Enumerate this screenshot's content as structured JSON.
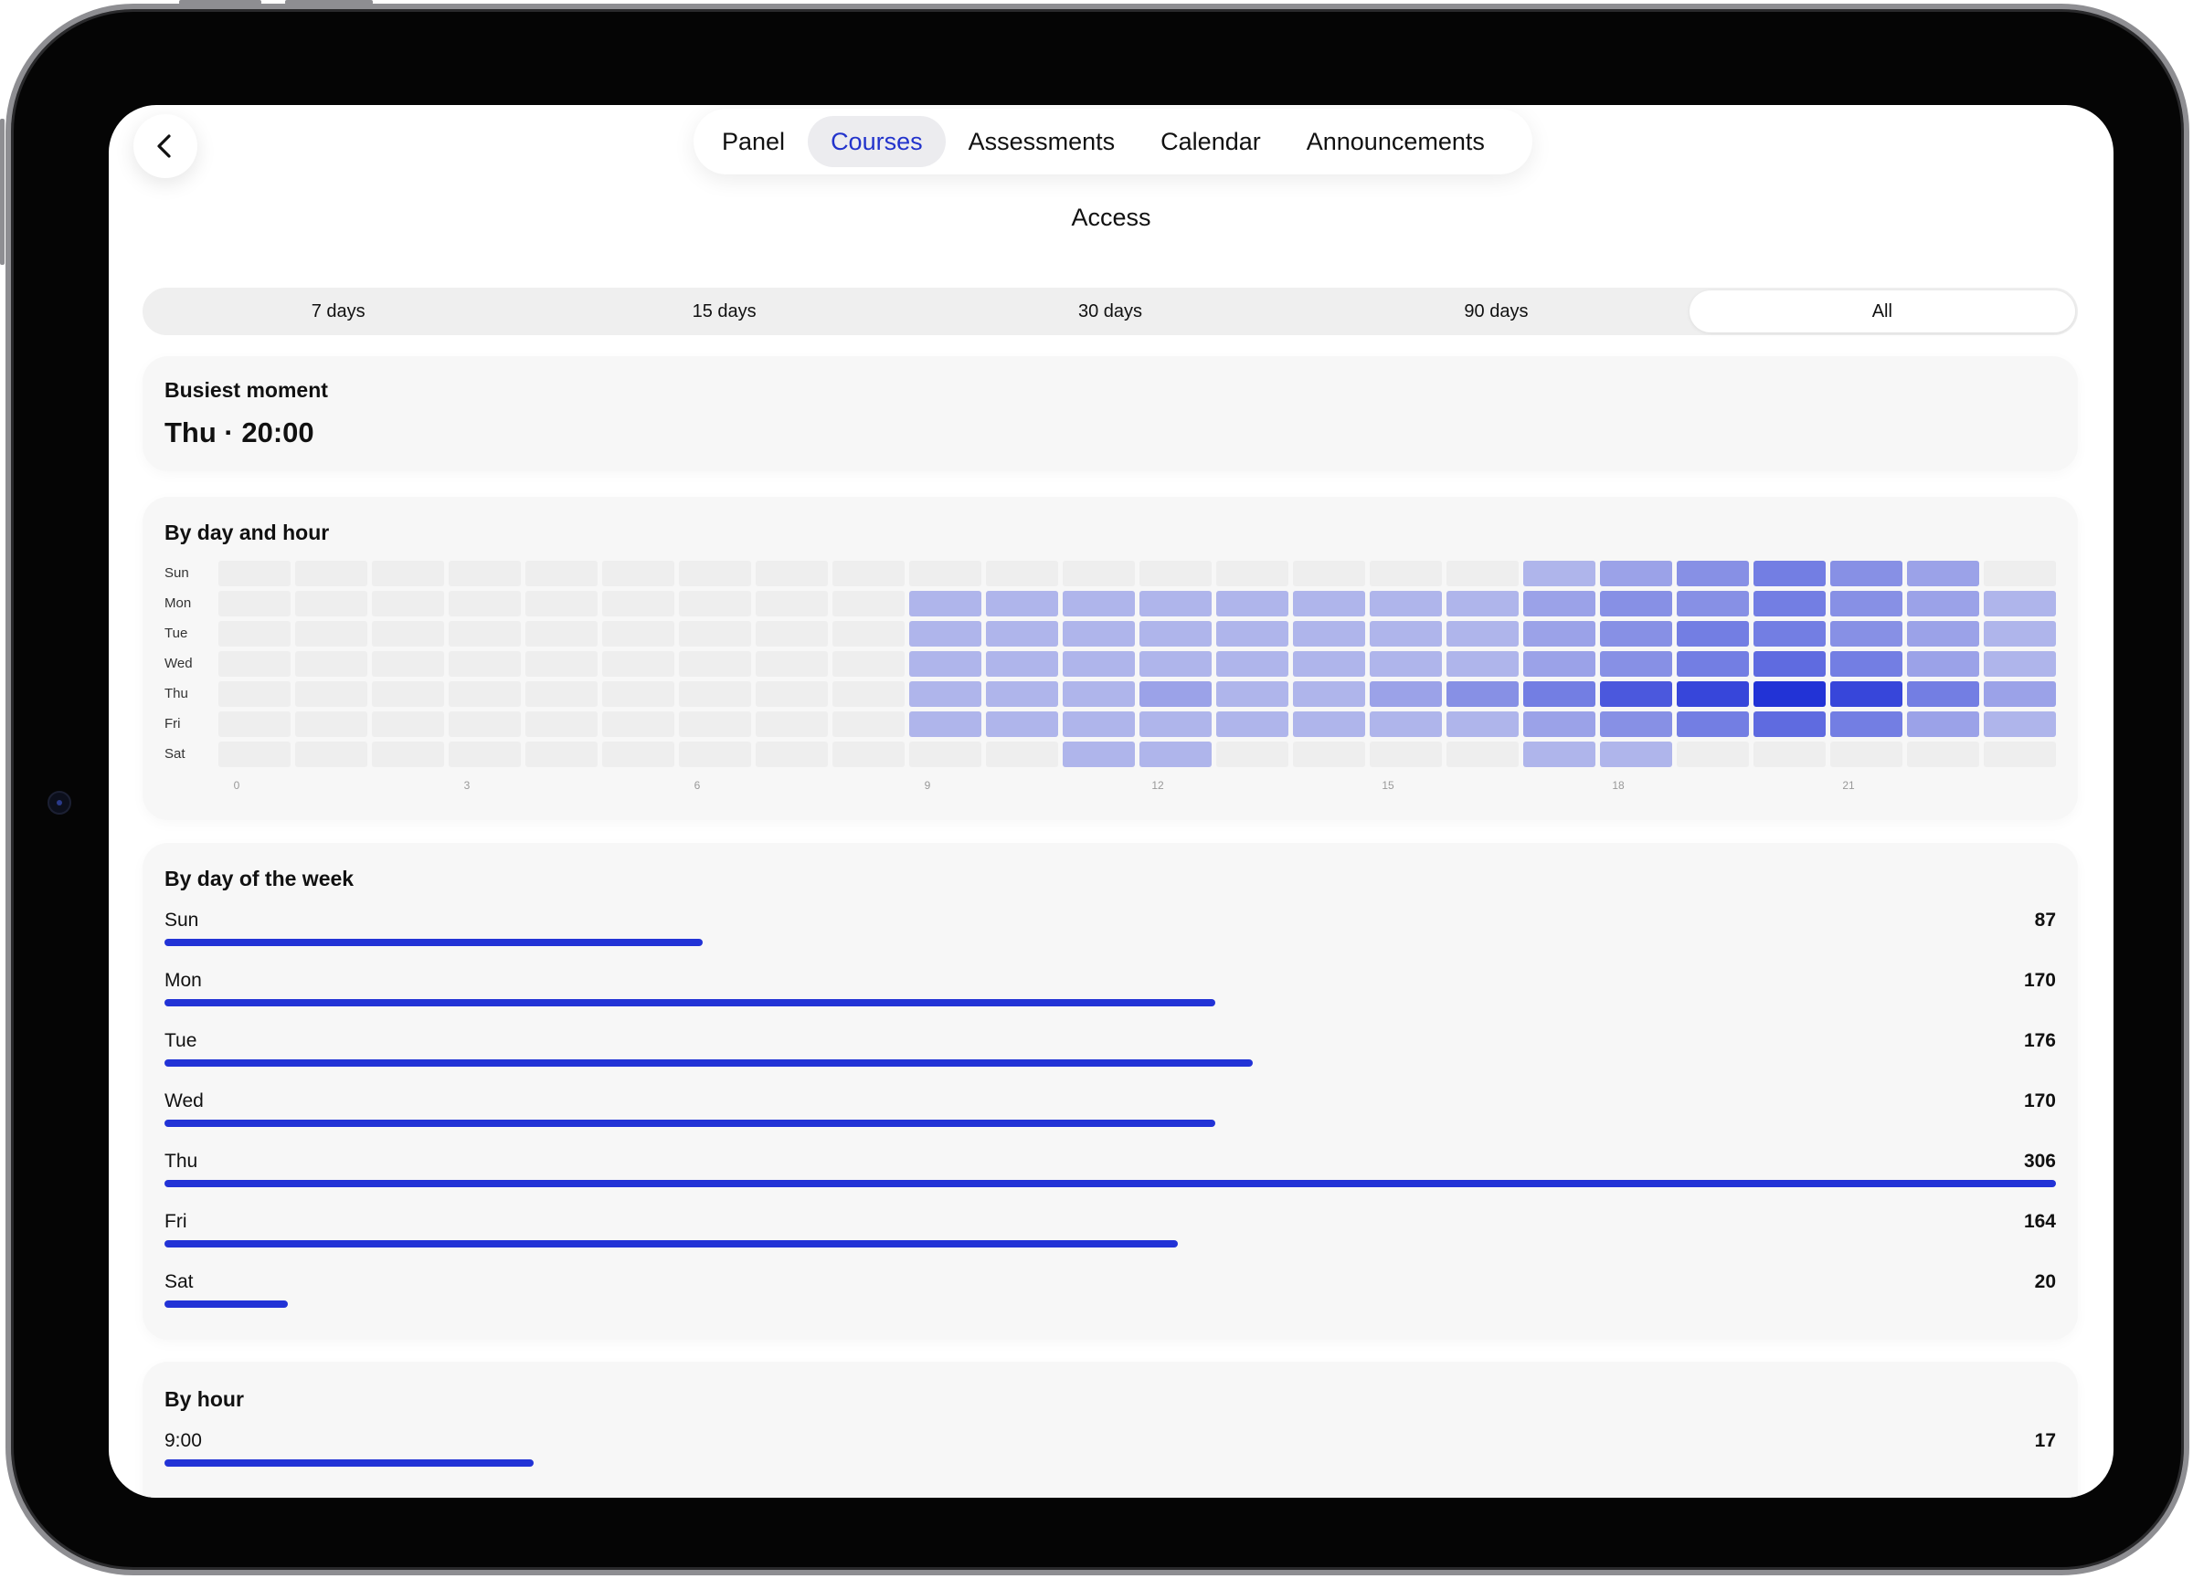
{
  "nav": {
    "back_icon": "chevron-left-icon",
    "tabs": [
      {
        "label": "Panel",
        "active": false
      },
      {
        "label": "Courses",
        "active": true
      },
      {
        "label": "Assessments",
        "active": false
      },
      {
        "label": "Calendar",
        "active": false
      },
      {
        "label": "Announcements",
        "active": false
      }
    ]
  },
  "page": {
    "title": "Access"
  },
  "ranges": {
    "options": [
      "7 days",
      "15 days",
      "30 days",
      "90 days",
      "All"
    ],
    "selected": "All"
  },
  "busiest": {
    "title": "Busiest moment",
    "value": "Thu · 20:00"
  },
  "heatmap": {
    "title": "By day and hour",
    "days": [
      "Sun",
      "Mon",
      "Tue",
      "Wed",
      "Thu",
      "Fri",
      "Sat"
    ],
    "hour_ticks": [
      "0",
      "3",
      "6",
      "9",
      "12",
      "15",
      "18",
      "21"
    ],
    "accent": "#2233d6",
    "empty_color": "#eeeeee",
    "levels": [
      [
        0,
        0,
        0,
        0,
        0,
        0,
        0,
        0,
        0,
        0,
        0,
        0,
        0,
        0,
        0,
        0,
        0,
        1,
        2,
        3,
        4,
        3,
        2,
        0
      ],
      [
        0,
        0,
        0,
        0,
        0,
        0,
        0,
        0,
        0,
        1,
        1,
        1,
        1,
        1,
        1,
        1,
        1,
        2,
        3,
        3,
        4,
        3,
        2,
        1
      ],
      [
        0,
        0,
        0,
        0,
        0,
        0,
        0,
        0,
        0,
        1,
        1,
        1,
        1,
        1,
        1,
        1,
        1,
        2,
        3,
        4,
        4,
        3,
        2,
        1
      ],
      [
        0,
        0,
        0,
        0,
        0,
        0,
        0,
        0,
        0,
        1,
        1,
        1,
        1,
        1,
        1,
        1,
        1,
        2,
        3,
        4,
        5,
        4,
        2,
        1
      ],
      [
        0,
        0,
        0,
        0,
        0,
        0,
        0,
        0,
        0,
        1,
        1,
        1,
        2,
        1,
        1,
        2,
        3,
        4,
        6,
        7,
        8,
        7,
        4,
        2
      ],
      [
        0,
        0,
        0,
        0,
        0,
        0,
        0,
        0,
        0,
        1,
        1,
        1,
        1,
        1,
        1,
        1,
        1,
        2,
        3,
        4,
        5,
        4,
        2,
        1
      ],
      [
        0,
        0,
        0,
        0,
        0,
        0,
        0,
        0,
        0,
        0,
        0,
        1,
        1,
        0,
        0,
        0,
        0,
        1,
        1,
        0,
        0,
        0,
        0,
        0
      ]
    ]
  },
  "by_week": {
    "title": "By day of the week",
    "max": 306,
    "rows": [
      {
        "label": "Sun",
        "value": 87
      },
      {
        "label": "Mon",
        "value": 170
      },
      {
        "label": "Tue",
        "value": 176
      },
      {
        "label": "Wed",
        "value": 170
      },
      {
        "label": "Thu",
        "value": 306
      },
      {
        "label": "Fri",
        "value": 164
      },
      {
        "label": "Sat",
        "value": 20
      }
    ]
  },
  "by_hour": {
    "title": "By hour",
    "max": 87,
    "rows": [
      {
        "label": "9:00",
        "value": 17
      }
    ]
  }
}
